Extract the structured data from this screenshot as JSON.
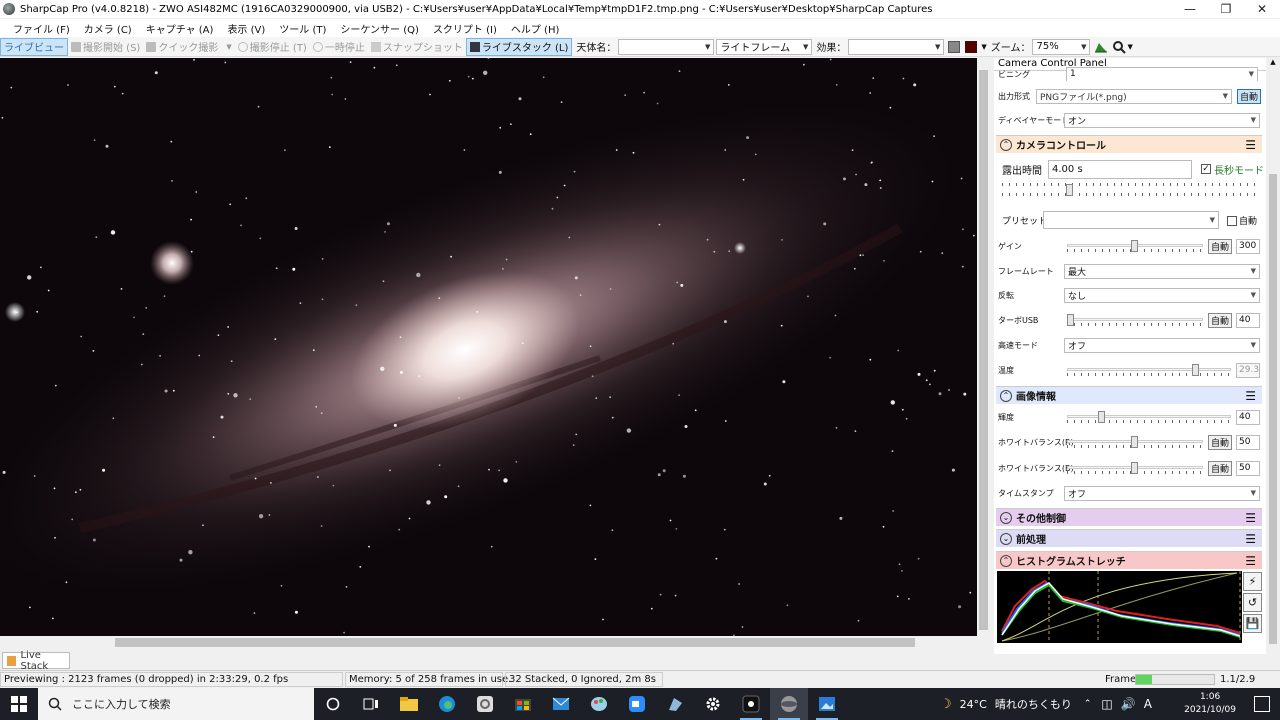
{
  "window": {
    "title": "SharpCap Pro (v4.0.8218) - ZWO ASI482MC (1916CA0329000900, via USB2) - C:¥Users¥user¥AppData¥Local¥Temp¥tmpD1F2.tmp.png - C:¥Users¥user¥Desktop¥SharpCap Captures"
  },
  "menu": [
    "ファイル (F)",
    "カメラ (C)",
    "キャプチャ (A)",
    "表示 (V)",
    "ツール (T)",
    "シーケンサー (Q)",
    "スクリプト (I)",
    "ヘルプ (H)"
  ],
  "toolbar": {
    "live_view": "ライブビュー",
    "start_capture": "撮影開始 (S)",
    "quick_capture": "クイック撮影",
    "stop_capture": "撮影停止 (T)",
    "pause": "一時停止",
    "snapshot": "スナップショット",
    "live_stack": "ライブスタック (L)",
    "target_label": "天体名：",
    "target_value": "",
    "frame_type": "ライトフレーム",
    "effect_label": "効果：",
    "effect_value": "",
    "zoom_label": "ズーム：",
    "zoom_value": "75%"
  },
  "panel": {
    "title": "Camera Control Panel",
    "top_row_label": "ビニング",
    "top_row_value": "1",
    "output_format_label": "出力形式",
    "output_format_value": "PNGファイル(*.png)",
    "output_auto": "自動",
    "debayer_label": "ディベイヤーモード",
    "debayer_value": "オン",
    "camera_controls": {
      "title": "カメラコントロール",
      "exposure_label": "露出時間",
      "exposure_value": "4.00 s",
      "long_exposure_label": "長秒モード",
      "preset_label": "プリセット",
      "preset_value": "",
      "preset_auto": "自動",
      "gain_label": "ゲイン",
      "gain_auto": "自動",
      "gain_value": "300",
      "gain_level": 0.5,
      "framerate_label": "フレームレート",
      "framerate_value": "最大",
      "flip_label": "反転",
      "flip_value": "なし",
      "turbo_label": "ターボUSB",
      "turbo_auto": "自動",
      "turbo_value": "40",
      "turbo_level": 0.0,
      "highspeed_label": "高速モード",
      "highspeed_value": "オフ",
      "temp_label": "温度",
      "temp_value": "29.3",
      "temp_level": 0.8
    },
    "image_info": {
      "title": "画像情報",
      "brightness_label": "輝度",
      "brightness_value": "40",
      "brightness_level": 0.2,
      "wb_r_label": "ホワイトバランス(R)",
      "wb_r_auto": "自動",
      "wb_r_value": "50",
      "wb_r_level": 0.5,
      "wb_b_label": "ホワイトバランス(B)",
      "wb_b_auto": "自動",
      "wb_b_value": "50",
      "wb_b_level": 0.5,
      "timestamp_label": "タイムスタンプ",
      "timestamp_value": "オフ"
    },
    "other_controls_title": "その他制御",
    "preprocess_title": "前処理",
    "histogram_title": "ヒストグラムストレッチ",
    "colors": {
      "camera_controls_bg": "#fde7d2",
      "image_info_bg": "#dfe9fb",
      "other_controls_bg": "#e4cdee",
      "preprocess_bg": "#dcdcf5",
      "histogram_bg": "#f8c8c8"
    }
  },
  "livestack_tab": "Live Stack",
  "status": {
    "preview": "Previewing : 2123 frames (0 dropped) in 2:33:29, 0.2 fps",
    "memory": "Memory: 5 of 258 frames in use.",
    "stacked": "32 Stacked, 0 Ignored, 2m 8s",
    "frame_label": "Frame:",
    "frame_value": "1.1/2.9",
    "frame_progress": 0.2
  },
  "taskbar": {
    "search_placeholder": "ここに入力して検索",
    "weather_temp": "24°C",
    "weather_desc": "晴れのちくもり",
    "ime": "A",
    "time": "1:06",
    "date": "2021/10/09"
  }
}
